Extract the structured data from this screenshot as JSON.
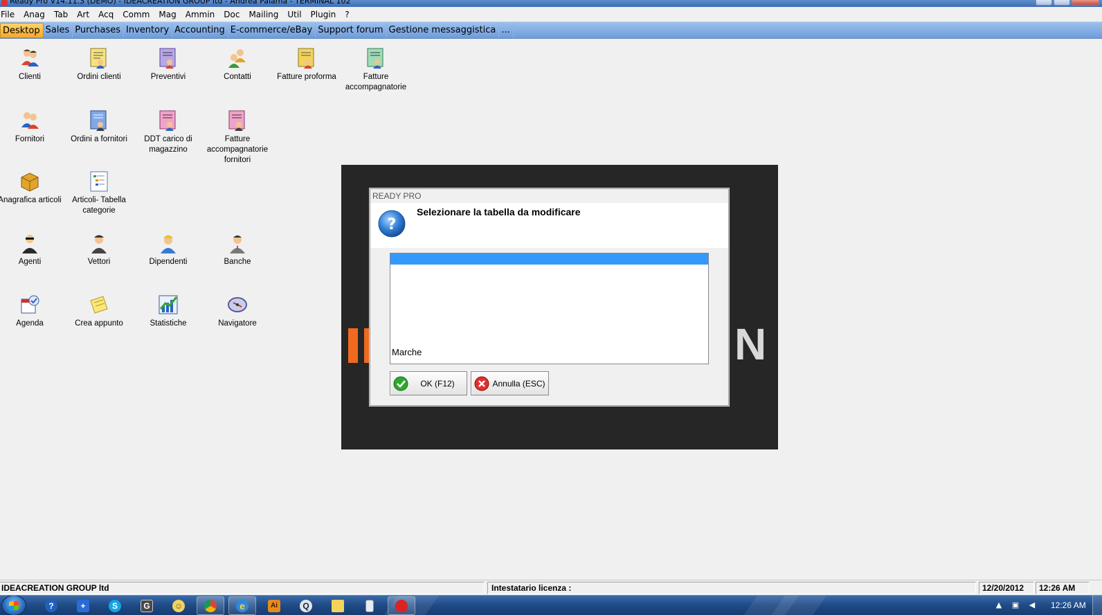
{
  "window": {
    "title": "Ready Pro V14.11.3 (DEMO) - IDEACREATION GROUP ltd - Andrea Palama - TERMINAL 102"
  },
  "menu": [
    "File",
    "Anag",
    "Tab",
    "Art",
    "Acq",
    "Comm",
    "Mag",
    "Ammin",
    "Doc",
    "Mailing",
    "Util",
    "Plugin",
    "?"
  ],
  "tabs": [
    {
      "label": "Desktop",
      "active": true
    },
    {
      "label": "Sales"
    },
    {
      "label": "Purchases"
    },
    {
      "label": "Inventory"
    },
    {
      "label": "Accounting"
    },
    {
      "label": "E-commerce/eBay"
    },
    {
      "label": "Support forum"
    },
    {
      "label": "Gestione messaggistica"
    },
    {
      "label": "..."
    }
  ],
  "desktop_icons": [
    {
      "label": "Clienti",
      "icon": "customers-icon"
    },
    {
      "label": "Ordini clienti",
      "icon": "customer-orders-icon"
    },
    {
      "label": "Preventivi",
      "icon": "quotes-icon"
    },
    {
      "label": "Contatti",
      "icon": "contacts-icon"
    },
    {
      "label": "Fatture proforma",
      "icon": "proforma-invoices-icon"
    },
    {
      "label": "Fatture accompagnatorie",
      "icon": "accompanying-invoices-icon"
    },
    {
      "label": "Fornitori",
      "icon": "suppliers-icon"
    },
    {
      "label": "Ordini a fornitori",
      "icon": "supplier-orders-icon"
    },
    {
      "label": "DDT carico di magazzino",
      "icon": "warehouse-ddt-icon"
    },
    {
      "label": "Fatture accompagnatorie fornitori",
      "icon": "supplier-invoices-icon"
    },
    {
      "label": "Anagrafica articoli",
      "icon": "items-box-icon"
    },
    {
      "label": "Articoli- Tabella categorie",
      "icon": "category-tree-icon"
    },
    {
      "label": "Agenti",
      "icon": "agent-icon"
    },
    {
      "label": "Vettori",
      "icon": "carrier-icon"
    },
    {
      "label": "Dipendenti",
      "icon": "employee-icon"
    },
    {
      "label": "Banche",
      "icon": "bank-icon"
    },
    {
      "label": "Agenda",
      "icon": "agenda-icon"
    },
    {
      "label": "Crea appunto",
      "icon": "note-icon"
    },
    {
      "label": "Statistiche",
      "icon": "statistics-icon"
    },
    {
      "label": "Navigatore",
      "icon": "navigator-icon"
    }
  ],
  "dialog": {
    "caption": "READY PRO",
    "message": "Selezionare la tabella da modificare",
    "list_items": [
      "",
      "Marche"
    ],
    "ok_label": "OK (F12)",
    "cancel_label": "Annulla (ESC)"
  },
  "statusbar": {
    "company": "IDEACREATION GROUP ltd",
    "license": "Intestatario licenza :",
    "date": "12/20/2012",
    "time": "12:26 AM"
  },
  "taskbar": {
    "buttons": [
      "help-icon",
      "cross-icon",
      "skype-icon",
      "tool-icon",
      "messenger-icon",
      "chrome-icon",
      "ie-icon",
      "illustrator-icon",
      "qt-icon",
      "folder-icon",
      "calculator-icon",
      "strawberry-icon"
    ],
    "clock": "12:26 AM"
  },
  "colors": {
    "tab_active": "#f6a82a",
    "tabbar": "#6d9cdb",
    "selection": "#3399ff",
    "splash_bg": "#262626",
    "logo_orange": "#ef6a1f"
  }
}
